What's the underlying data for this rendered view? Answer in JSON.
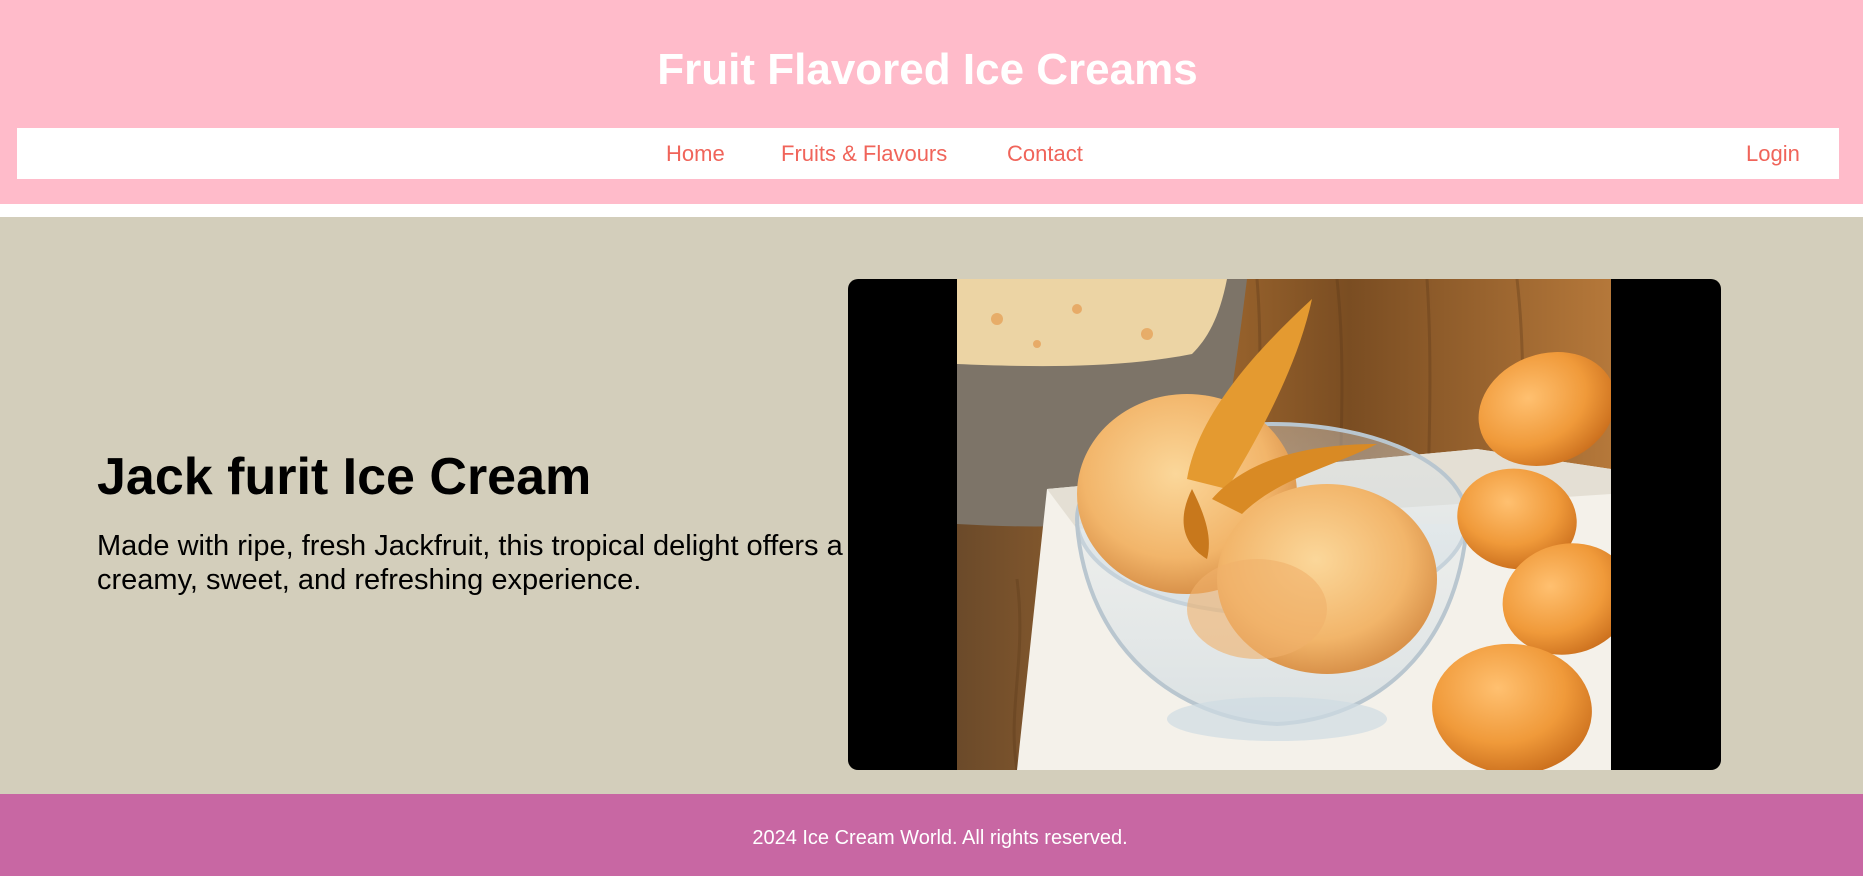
{
  "header": {
    "title": "Fruit Flavored Ice Creams"
  },
  "nav": {
    "home": "Home",
    "fruits": "Fruits & Flavours",
    "contact": "Contact",
    "login": "Login"
  },
  "hero": {
    "title": "Jack furit Ice Cream",
    "description": "Made with ripe, fresh Jackfruit, this tropical delight offers a creamy, sweet, and refreshing experience."
  },
  "footer": {
    "text": "2024 Ice Cream World. All rights reserved."
  },
  "colors": {
    "header_bg": "#ffbbca",
    "nav_link": "#f0645a",
    "hero_bg": "#d3cebb",
    "footer_bg": "#c867a3"
  }
}
